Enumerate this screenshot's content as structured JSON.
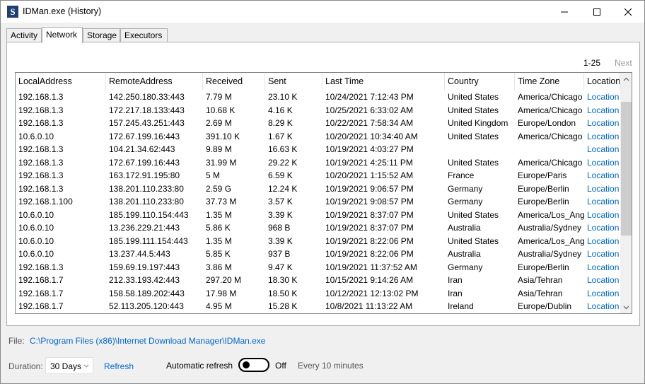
{
  "window": {
    "title": "IDMan.exe (History)",
    "icon_letter": "S"
  },
  "tabs": [
    {
      "label": "Activity",
      "active": false
    },
    {
      "label": "Network",
      "active": true
    },
    {
      "label": "Storage",
      "active": false
    },
    {
      "label": "Executors",
      "active": false
    }
  ],
  "pager": {
    "range": "1-25",
    "next_label": "Next"
  },
  "table": {
    "columns": [
      "LocalAddress",
      "RemoteAddress",
      "Received",
      "Sent",
      "Last Time",
      "Country",
      "Time Zone",
      "Location"
    ],
    "rows": [
      [
        "192.168.1.3",
        "142.250.180.33:443",
        "7.79 M",
        "23.10 K",
        "10/24/2021 7:12:43 PM",
        "United States",
        "America/Chicago",
        "Location"
      ],
      [
        "192.168.1.3",
        "172.217.18.133:443",
        "10.68 K",
        "4.16 K",
        "10/25/2021 6:33:02 AM",
        "United States",
        "America/Chicago",
        "Location"
      ],
      [
        "192.168.1.3",
        "157.245.43.251:443",
        "2.69 M",
        "8.29 K",
        "10/22/2021 7:58:34 AM",
        "United Kingdom",
        "Europe/London",
        "Location"
      ],
      [
        "10.6.0.10",
        "172.67.199.16:443",
        "391.10 K",
        "1.67 K",
        "10/20/2021 10:34:40 AM",
        "United States",
        "America/Chicago",
        "Location"
      ],
      [
        "192.168.1.3",
        "104.21.34.62:443",
        "9.89 M",
        "16.63 K",
        "10/19/2021 4:03:27 PM",
        "",
        "",
        "Location"
      ],
      [
        "192.168.1.3",
        "172.67.199.16:443",
        "31.99 M",
        "29.22 K",
        "10/19/2021 4:25:11 PM",
        "United States",
        "America/Chicago",
        "Location"
      ],
      [
        "192.168.1.3",
        "163.172.91.195:80",
        "5 M",
        "6.59 K",
        "10/20/2021 1:15:52 AM",
        "France",
        "Europe/Paris",
        "Location"
      ],
      [
        "192.168.1.3",
        "138.201.110.233:80",
        "2.59 G",
        "12.24 K",
        "10/19/2021 9:06:57 PM",
        "Germany",
        "Europe/Berlin",
        "Location"
      ],
      [
        "192.168.1.100",
        "138.201.110.233:80",
        "37.73 M",
        "3.57 K",
        "10/19/2021 9:08:57 PM",
        "Germany",
        "Europe/Berlin",
        "Location"
      ],
      [
        "10.6.0.10",
        "185.199.110.154:443",
        "1.35 M",
        "3.39 K",
        "10/19/2021 8:37:07 PM",
        "United States",
        "America/Los_Angeles",
        "Location"
      ],
      [
        "10.6.0.10",
        "13.236.229.21:443",
        "5.86 K",
        "968 B",
        "10/19/2021 8:37:07 PM",
        "Australia",
        "Australia/Sydney",
        "Location"
      ],
      [
        "10.6.0.10",
        "185.199.111.154:443",
        "1.35 M",
        "3.39 K",
        "10/19/2021 8:22:06 PM",
        "United States",
        "America/Los_Angeles",
        "Location"
      ],
      [
        "10.6.0.10",
        "13.237.44.5:443",
        "5.85 K",
        "937 B",
        "10/19/2021 8:22:06 PM",
        "Australia",
        "Australia/Sydney",
        "Location"
      ],
      [
        "192.168.1.3",
        "159.69.19.197:443",
        "3.86 M",
        "9.47 K",
        "10/19/2021 11:37:52 AM",
        "Germany",
        "Europe/Berlin",
        "Location"
      ],
      [
        "192.168.1.7",
        "212.33.193.42:443",
        "297.20 M",
        "18.30 K",
        "10/15/2021 9:14:26 AM",
        "Iran",
        "Asia/Tehran",
        "Location"
      ],
      [
        "192.168.1.7",
        "158.58.189.202:443",
        "17.98 M",
        "18.50 K",
        "10/12/2021 12:13:02 PM",
        "Iran",
        "Asia/Tehran",
        "Location"
      ],
      [
        "192.168.1.7",
        "52.113.205.120:443",
        "4.95 M",
        "15.28 K",
        "10/8/2021 11:13:22 AM",
        "Ireland",
        "Europe/Dublin",
        "Location"
      ]
    ]
  },
  "file": {
    "label": "File:",
    "path": "C:\\Program Files (x86)\\Internet Download Manager\\IDMan.exe"
  },
  "controls": {
    "duration_label": "Duration:",
    "duration_value": "30 Days",
    "refresh_label": "Refresh",
    "auto_refresh_label": "Automatic refresh",
    "toggle_state": "Off",
    "interval_text": "Every 10 minutes"
  },
  "colors": {
    "link": "#0066cc",
    "title_icon": "#1e3f73"
  }
}
